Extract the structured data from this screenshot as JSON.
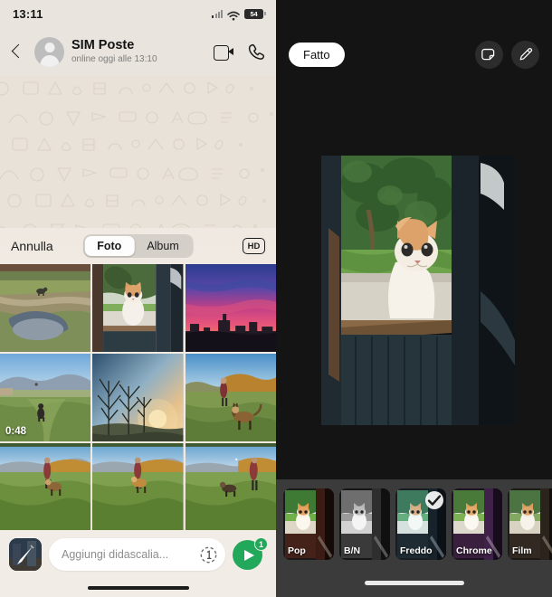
{
  "left_panel": {
    "status_bar": {
      "time": "13:11",
      "cellular_icon": "cellular-signal-icon",
      "wifi_icon": "wifi-icon",
      "battery_level": "54"
    },
    "chat_header": {
      "back_icon": "back-arrow-icon",
      "avatar_icon": "contact-avatar-placeholder",
      "contact_name": "SIM Poste",
      "presence": "online oggi alle 13:10",
      "video_call_icon": "video-camera-icon",
      "voice_call_icon": "phone-icon"
    },
    "picker": {
      "cancel_label": "Annulla",
      "tabs": [
        {
          "label": "Foto",
          "active": true
        },
        {
          "label": "Album",
          "active": false
        }
      ],
      "hd_label": "HD",
      "hd_icon": "hd-quality-icon",
      "photos": [
        {
          "name": "dog-on-stone-bridge-over-stream",
          "duration": ""
        },
        {
          "name": "ginger-white-cat-at-window",
          "duration": ""
        },
        {
          "name": "pink-purple-sunset-over-town",
          "duration": ""
        },
        {
          "name": "dog-running-in-field-video",
          "duration": "0:48"
        },
        {
          "name": "bare-trees-at-sunrise",
          "duration": ""
        },
        {
          "name": "person-and-german-shepherd-in-field",
          "duration": ""
        },
        {
          "name": "person-walking-dog-in-meadow-a",
          "duration": ""
        },
        {
          "name": "person-walking-dog-in-meadow-b",
          "duration": ""
        },
        {
          "name": "person-standing-with-dog-in-meadow",
          "duration": ""
        }
      ]
    },
    "composer": {
      "attachment_thumb_icon": "selected-photo-thumbnail-with-edit-pencil",
      "caption_placeholder": "Aggiungi didascalia...",
      "view_once_icon": "view-once-icon",
      "view_once_label": "1",
      "send_icon": "send-icon",
      "send_count": "1"
    }
  },
  "right_panel": {
    "done_label": "Fatto",
    "tools": [
      {
        "name": "sticker-icon"
      },
      {
        "name": "pencil-draw-icon"
      }
    ],
    "photo": {
      "name": "ginger-white-cat-at-window-preview"
    },
    "filters": [
      {
        "label": "Pop",
        "selected": false
      },
      {
        "label": "B/N",
        "selected": false
      },
      {
        "label": "Freddo",
        "selected": true
      },
      {
        "label": "Chrome",
        "selected": false
      },
      {
        "label": "Film",
        "selected": false
      }
    ],
    "selected_filter_icon": "checkmark-icon"
  },
  "colors": {
    "whatsapp_green": "#21a85a",
    "chat_bg": "#e8e2d9",
    "header_bg": "#e9e4dd",
    "editor_bg": "#141414",
    "filter_bar_bg": "#3b3b3b"
  }
}
